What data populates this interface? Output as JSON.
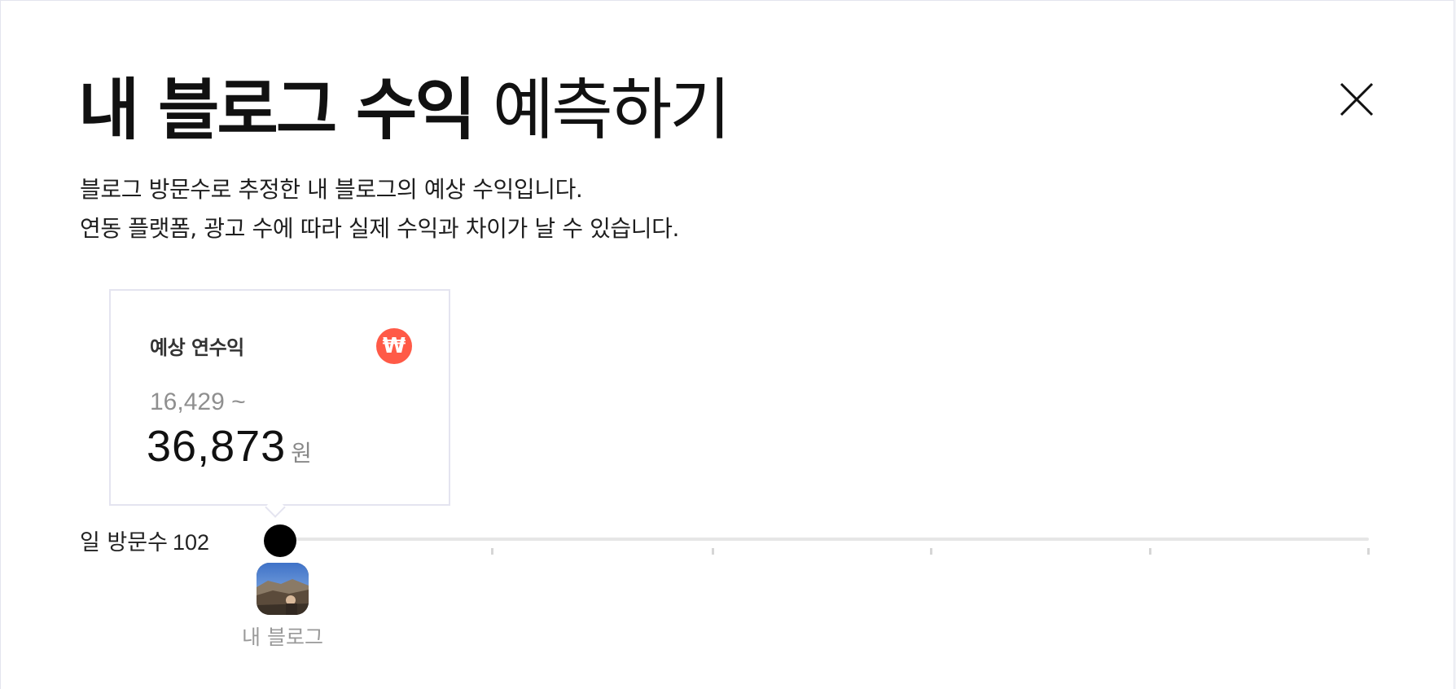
{
  "header": {
    "title_bold": "내 블로그 수익",
    "title_light": "예측하기"
  },
  "description": {
    "line1": "블로그 방문수로 추정한 내 블로그의 예상 수익입니다.",
    "line2": "연동 플랫폼, 광고 수에 따라 실제 수익과 차이가 날 수 있습니다."
  },
  "estimate_card": {
    "label": "예상 연수익",
    "icon": "won-currency-icon",
    "icon_glyph": "₩",
    "icon_color": "#ff5a47",
    "range_min": "16,429 ~",
    "range_max": "36,873",
    "unit": "원"
  },
  "slider": {
    "label": "일 방문수",
    "value": "102",
    "position_fraction": 0.0
  },
  "my_blog": {
    "label": "내 블로그"
  },
  "icons": {
    "close": "close-icon"
  }
}
